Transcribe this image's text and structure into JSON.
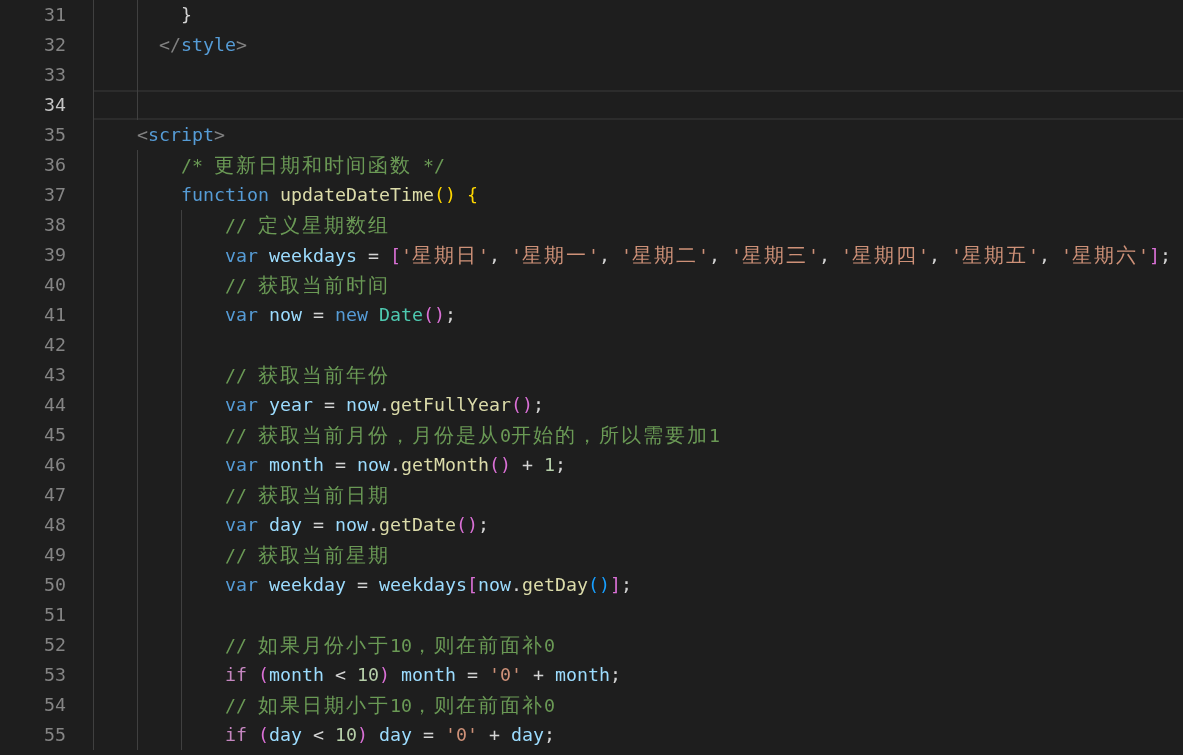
{
  "editor": {
    "lines": [
      {
        "number": "31",
        "active": false,
        "tokens": [
          {
            "kind": "punct",
            "text": "        }"
          }
        ]
      },
      {
        "number": "32",
        "active": false,
        "tokens": [
          {
            "kind": "tag-bracket",
            "text": "      </"
          },
          {
            "kind": "tag",
            "text": "style"
          },
          {
            "kind": "tag-bracket",
            "text": ">"
          }
        ]
      },
      {
        "number": "33",
        "active": false
      },
      {
        "number": "34",
        "active": true
      },
      {
        "number": "35",
        "active": false,
        "tokens": [
          {
            "kind": "tag-bracket",
            "text": "    <"
          },
          {
            "kind": "tag",
            "text": "script"
          },
          {
            "kind": "tag-bracket",
            "text": ">"
          }
        ]
      },
      {
        "number": "36",
        "active": false,
        "tokens": [
          {
            "kind": "comment",
            "text": "        /* 更新日期和时间函数 */"
          }
        ]
      },
      {
        "number": "37",
        "active": false,
        "tokens": [
          {
            "kind": "keyword",
            "text": "        function "
          },
          {
            "kind": "function",
            "text": "updateDateTime"
          },
          {
            "kind": "bracket-1",
            "text": "() {"
          }
        ]
      },
      {
        "number": "38",
        "active": false,
        "tokens": [
          {
            "kind": "comment",
            "text": "            // 定义星期数组"
          }
        ]
      },
      {
        "number": "39",
        "active": false,
        "tokens": [
          {
            "kind": "keyword",
            "text": "            var "
          },
          {
            "kind": "variable",
            "text": "weekdays "
          },
          {
            "kind": "punct",
            "text": "= "
          },
          {
            "kind": "bracket-2",
            "text": "["
          },
          {
            "kind": "string",
            "text": "'星期日'"
          },
          {
            "kind": "punct",
            "text": ", "
          },
          {
            "kind": "string",
            "text": "'星期一'"
          },
          {
            "kind": "punct",
            "text": ", "
          },
          {
            "kind": "string",
            "text": "'星期二'"
          },
          {
            "kind": "punct",
            "text": ", "
          },
          {
            "kind": "string",
            "text": "'星期三'"
          },
          {
            "kind": "punct",
            "text": ", "
          },
          {
            "kind": "string",
            "text": "'星期四'"
          },
          {
            "kind": "punct",
            "text": ", "
          },
          {
            "kind": "string",
            "text": "'星期五'"
          },
          {
            "kind": "punct",
            "text": ", "
          },
          {
            "kind": "string",
            "text": "'星期六'"
          },
          {
            "kind": "bracket-2",
            "text": "]"
          },
          {
            "kind": "punct",
            "text": ";"
          }
        ]
      },
      {
        "number": "40",
        "active": false,
        "tokens": [
          {
            "kind": "comment",
            "text": "            // 获取当前时间"
          }
        ]
      },
      {
        "number": "41",
        "active": false,
        "tokens": [
          {
            "kind": "keyword",
            "text": "            var "
          },
          {
            "kind": "variable",
            "text": "now "
          },
          {
            "kind": "punct",
            "text": "= "
          },
          {
            "kind": "keyword",
            "text": "new "
          },
          {
            "kind": "class",
            "text": "Date"
          },
          {
            "kind": "bracket-2",
            "text": "()"
          },
          {
            "kind": "punct",
            "text": ";"
          }
        ]
      },
      {
        "number": "42",
        "active": false
      },
      {
        "number": "43",
        "active": false,
        "tokens": [
          {
            "kind": "comment",
            "text": "            // 获取当前年份"
          }
        ]
      },
      {
        "number": "44",
        "active": false,
        "tokens": [
          {
            "kind": "keyword",
            "text": "            var "
          },
          {
            "kind": "variable",
            "text": "year "
          },
          {
            "kind": "punct",
            "text": "= "
          },
          {
            "kind": "variable",
            "text": "now"
          },
          {
            "kind": "punct",
            "text": "."
          },
          {
            "kind": "function",
            "text": "getFullYear"
          },
          {
            "kind": "bracket-2",
            "text": "()"
          },
          {
            "kind": "punct",
            "text": ";"
          }
        ]
      },
      {
        "number": "45",
        "active": false,
        "tokens": [
          {
            "kind": "comment",
            "text": "            // 获取当前月份，月份是从0开始的，所以需要加1"
          }
        ]
      },
      {
        "number": "46",
        "active": false,
        "tokens": [
          {
            "kind": "keyword",
            "text": "            var "
          },
          {
            "kind": "variable",
            "text": "month "
          },
          {
            "kind": "punct",
            "text": "= "
          },
          {
            "kind": "variable",
            "text": "now"
          },
          {
            "kind": "punct",
            "text": "."
          },
          {
            "kind": "function",
            "text": "getMonth"
          },
          {
            "kind": "bracket-2",
            "text": "()"
          },
          {
            "kind": "punct",
            "text": " + "
          },
          {
            "kind": "number",
            "text": "1"
          },
          {
            "kind": "punct",
            "text": ";"
          }
        ]
      },
      {
        "number": "47",
        "active": false,
        "tokens": [
          {
            "kind": "comment",
            "text": "            // 获取当前日期"
          }
        ]
      },
      {
        "number": "48",
        "active": false,
        "tokens": [
          {
            "kind": "keyword",
            "text": "            var "
          },
          {
            "kind": "variable",
            "text": "day "
          },
          {
            "kind": "punct",
            "text": "= "
          },
          {
            "kind": "variable",
            "text": "now"
          },
          {
            "kind": "punct",
            "text": "."
          },
          {
            "kind": "function",
            "text": "getDate"
          },
          {
            "kind": "bracket-2",
            "text": "()"
          },
          {
            "kind": "punct",
            "text": ";"
          }
        ]
      },
      {
        "number": "49",
        "active": false,
        "tokens": [
          {
            "kind": "comment",
            "text": "            // 获取当前星期"
          }
        ]
      },
      {
        "number": "50",
        "active": false,
        "tokens": [
          {
            "kind": "keyword",
            "text": "            var "
          },
          {
            "kind": "variable",
            "text": "weekday "
          },
          {
            "kind": "punct",
            "text": "= "
          },
          {
            "kind": "variable",
            "text": "weekdays"
          },
          {
            "kind": "bracket-2",
            "text": "["
          },
          {
            "kind": "variable",
            "text": "now"
          },
          {
            "kind": "punct",
            "text": "."
          },
          {
            "kind": "function",
            "text": "getDay"
          },
          {
            "kind": "bracket-3",
            "text": "()"
          },
          {
            "kind": "bracket-2",
            "text": "]"
          },
          {
            "kind": "punct",
            "text": ";"
          }
        ]
      },
      {
        "number": "51",
        "active": false
      },
      {
        "number": "52",
        "active": false,
        "tokens": [
          {
            "kind": "comment",
            "text": "            // 如果月份小于10，则在前面补0"
          }
        ]
      },
      {
        "number": "53",
        "active": false,
        "tokens": [
          {
            "kind": "control",
            "text": "            if "
          },
          {
            "kind": "bracket-2",
            "text": "("
          },
          {
            "kind": "variable",
            "text": "month"
          },
          {
            "kind": "punct",
            "text": " < "
          },
          {
            "kind": "number",
            "text": "10"
          },
          {
            "kind": "bracket-2",
            "text": ") "
          },
          {
            "kind": "variable",
            "text": "month "
          },
          {
            "kind": "punct",
            "text": "= "
          },
          {
            "kind": "string",
            "text": "'0'"
          },
          {
            "kind": "punct",
            "text": " + "
          },
          {
            "kind": "variable",
            "text": "month"
          },
          {
            "kind": "punct",
            "text": ";"
          }
        ]
      },
      {
        "number": "54",
        "active": false,
        "tokens": [
          {
            "kind": "comment",
            "text": "            // 如果日期小于10，则在前面补0"
          }
        ]
      },
      {
        "number": "55",
        "active": false,
        "tokens": [
          {
            "kind": "control",
            "text": "            if "
          },
          {
            "kind": "bracket-2",
            "text": "("
          },
          {
            "kind": "variable",
            "text": "day"
          },
          {
            "kind": "punct",
            "text": " < "
          },
          {
            "kind": "number",
            "text": "10"
          },
          {
            "kind": "bracket-2",
            "text": ") "
          },
          {
            "kind": "variable",
            "text": "day "
          },
          {
            "kind": "punct",
            "text": "= "
          },
          {
            "kind": "string",
            "text": "'0'"
          },
          {
            "kind": "punct",
            "text": " + "
          },
          {
            "kind": "variable",
            "text": "day"
          },
          {
            "kind": "punct",
            "text": ";"
          }
        ]
      }
    ]
  }
}
